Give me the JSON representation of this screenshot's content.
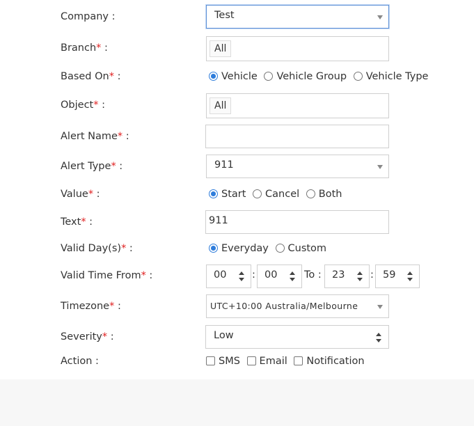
{
  "company": {
    "label": "Company :",
    "value": "Test"
  },
  "branch": {
    "label": "Branch",
    "tag": "All"
  },
  "based_on": {
    "label": "Based On",
    "options": [
      "Vehicle",
      "Vehicle Group",
      "Vehicle Type"
    ],
    "selected": "Vehicle"
  },
  "object": {
    "label": "Object",
    "tag": "All"
  },
  "alert_name": {
    "label": "Alert Name",
    "value": ""
  },
  "alert_type": {
    "label": "Alert Type",
    "value": "911"
  },
  "value": {
    "label": "Value",
    "options": [
      "Start",
      "Cancel",
      "Both"
    ],
    "selected": "Start"
  },
  "text": {
    "label": "Text",
    "value": "911"
  },
  "valid_days": {
    "label": "Valid Day(s)",
    "options": [
      "Everyday",
      "Custom"
    ],
    "selected": "Everyday"
  },
  "valid_time": {
    "label": "Valid Time From",
    "from_hour": "00",
    "from_minute": "00",
    "to_label": "To :",
    "to_hour": "23",
    "to_minute": "59",
    "colon": ":"
  },
  "timezone": {
    "label": "Timezone",
    "value": "UTC+10:00 Australia/Melbourne"
  },
  "severity": {
    "label": "Severity",
    "value": "Low"
  },
  "action": {
    "label": "Action :",
    "options": [
      "SMS",
      "Email",
      "Notification"
    ]
  },
  "required_mark": "*",
  "label_suffix": " :",
  "colors": {
    "accent": "#2f7ddb",
    "required": "#e02020",
    "focus_border": "#5b8fd6"
  }
}
